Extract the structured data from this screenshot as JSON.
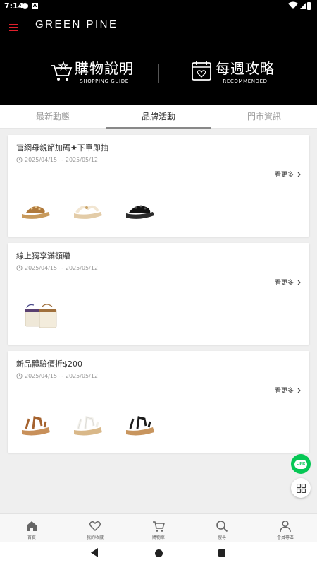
{
  "status_bar": {
    "time": "7:14",
    "notification_icon": "A"
  },
  "header": {
    "brand": "GREEN PINE",
    "shopping_guide": {
      "title": "購物說明",
      "subtitle": "SHOPPING GUIDE"
    },
    "recommended": {
      "title": "每週攻略",
      "subtitle": "RECOMMENDED"
    },
    "accent_color": "#e0202c"
  },
  "tabs": [
    {
      "label": "最新動態",
      "active": false
    },
    {
      "label": "品牌活動",
      "active": true
    },
    {
      "label": "門市資訊",
      "active": false
    }
  ],
  "cards": [
    {
      "title": "官網母親節加碼★下單即抽",
      "date": "2025/04/15 ~ 2025/05/12",
      "more_label": "看更多",
      "products": [
        "tan-beaded-wedge-sandal",
        "beige-thong-wedge-sandal",
        "black-floral-wedge-sandal"
      ]
    },
    {
      "title": "線上獨享滿額贈",
      "date": "2025/04/15 ~ 2025/05/12",
      "more_label": "看更多",
      "products": [
        "woven-crossbody-bags"
      ]
    },
    {
      "title": "新品體驗價折$200",
      "date": "2025/04/15 ~ 2025/05/12",
      "more_label": "看更多",
      "products": [
        "brown-strappy-wedge-sandal",
        "white-strappy-wedge-sandal",
        "black-strappy-wedge-sandal"
      ]
    }
  ],
  "floating": {
    "line_label": "LINE"
  },
  "bottom_nav": [
    {
      "label": "首頁",
      "icon": "home-icon"
    },
    {
      "label": "我的收藏",
      "icon": "heart-icon"
    },
    {
      "label": "購物車",
      "icon": "cart-icon"
    },
    {
      "label": "搜尋",
      "icon": "search-icon"
    },
    {
      "label": "會員專區",
      "icon": "user-icon"
    }
  ]
}
